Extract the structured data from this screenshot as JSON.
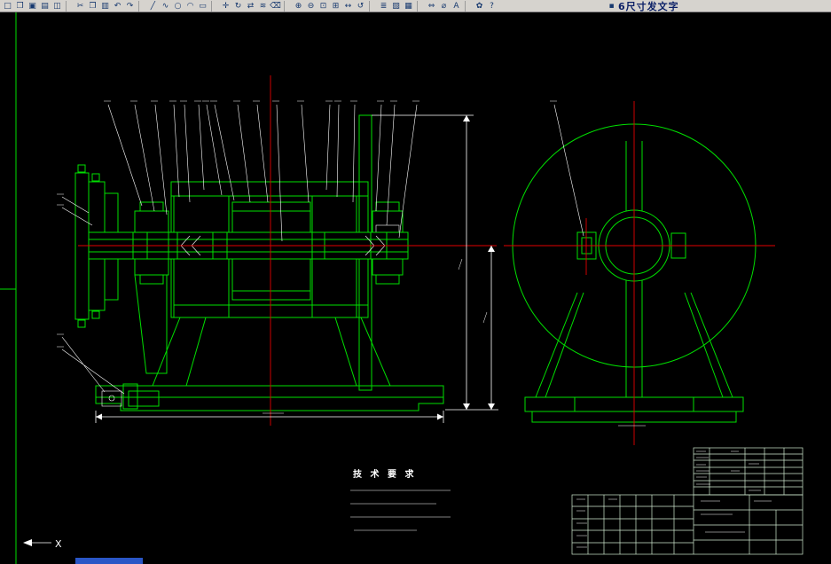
{
  "app": {
    "colors": {
      "toolbar-bg": "#d6d3ce",
      "icon": "#16386e",
      "title-text": "#0a1f66",
      "taskbar": "#2a56c6"
    }
  },
  "toolbar": {
    "title_text": "6尺寸发文字",
    "icons": [
      {
        "name": "new-file-icon",
        "glyph": "□"
      },
      {
        "name": "open-file-icon",
        "glyph": "❒"
      },
      {
        "name": "save-icon",
        "glyph": "▣"
      },
      {
        "name": "print-icon",
        "glyph": "▤"
      },
      {
        "name": "print-preview-icon",
        "glyph": "◫"
      },
      {
        "name": "cut-icon",
        "glyph": "✂"
      },
      {
        "name": "copy-icon",
        "glyph": "❐"
      },
      {
        "name": "paste-icon",
        "glyph": "▥"
      },
      {
        "name": "undo-icon",
        "glyph": "↶"
      },
      {
        "name": "redo-icon",
        "glyph": "↷"
      },
      {
        "name": "line-icon",
        "glyph": "╱"
      },
      {
        "name": "polyline-icon",
        "glyph": "∿"
      },
      {
        "name": "circle-icon",
        "glyph": "○"
      },
      {
        "name": "arc-icon",
        "glyph": "◠"
      },
      {
        "name": "rectangle-icon",
        "glyph": "▭"
      },
      {
        "name": "move-icon",
        "glyph": "✛"
      },
      {
        "name": "rotate-icon",
        "glyph": "↻"
      },
      {
        "name": "mirror-icon",
        "glyph": "⇄"
      },
      {
        "name": "offset-icon",
        "glyph": "≋"
      },
      {
        "name": "erase-icon",
        "glyph": "⌫"
      },
      {
        "name": "zoom-in-icon",
        "glyph": "⊕"
      },
      {
        "name": "zoom-out-icon",
        "glyph": "⊖"
      },
      {
        "name": "zoom-window-icon",
        "glyph": "⊡"
      },
      {
        "name": "zoom-extents-icon",
        "glyph": "⊞"
      },
      {
        "name": "pan-icon",
        "glyph": "↔"
      },
      {
        "name": "regen-icon",
        "glyph": "↺"
      },
      {
        "name": "layers-icon",
        "glyph": "≣"
      },
      {
        "name": "color-icon",
        "glyph": "▧"
      },
      {
        "name": "properties-icon",
        "glyph": "▦"
      },
      {
        "name": "dimension-linear-icon",
        "glyph": "⇔"
      },
      {
        "name": "dimension-diameter-icon",
        "glyph": "⌀"
      },
      {
        "name": "text-icon",
        "glyph": "A"
      },
      {
        "name": "palette-icon",
        "glyph": "✿"
      },
      {
        "name": "help-icon",
        "glyph": "?"
      },
      {
        "name": "block-icon",
        "glyph": "▪"
      }
    ]
  },
  "drawing": {
    "colors": {
      "entity": "#00df00",
      "centerline": "#e20000",
      "annotation": "#ffffff",
      "titleblock": "#cfe8cf"
    },
    "tech_requirements_title": "技 术 要 求",
    "ucs_axis_label": "X"
  }
}
